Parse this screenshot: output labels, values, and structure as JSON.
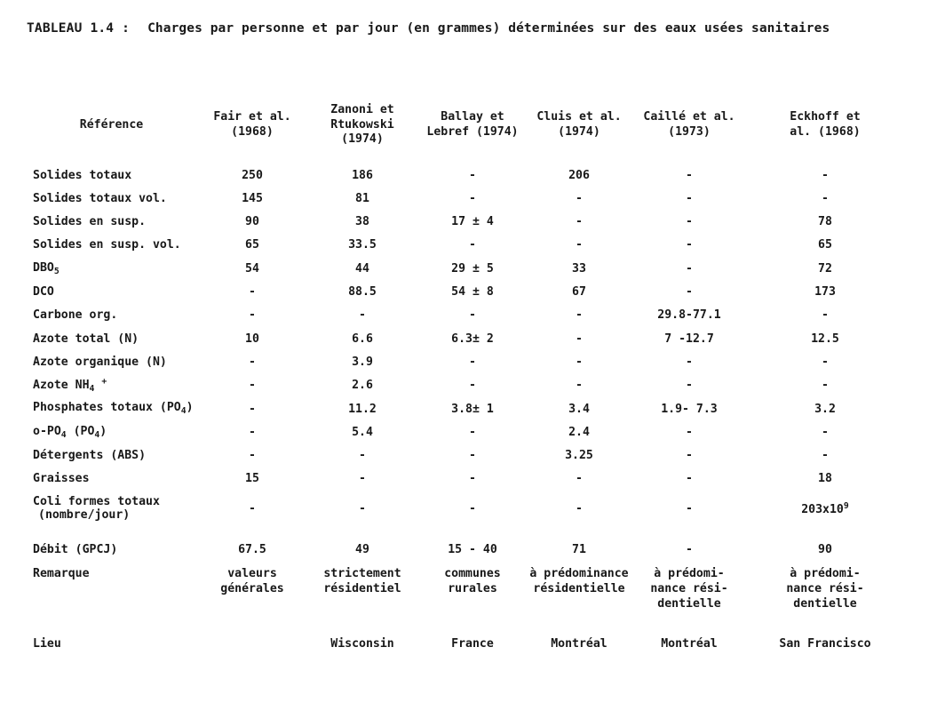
{
  "caption": {
    "label": "TABLEAU 1.4 :",
    "text": "Charges par personne et par jour  (en grammes)  déterminées sur des eaux usées sanitaires"
  },
  "table": {
    "header": {
      "reference_label": "Référence",
      "columns": [
        {
          "lines": [
            "Fair et al.",
            "(1968)"
          ]
        },
        {
          "lines": [
            "Zanoni et",
            "Rtukowski",
            "(1974)"
          ]
        },
        {
          "lines": [
            "Ballay et",
            "Lebref (1974)"
          ]
        },
        {
          "lines": [
            "Cluis et al.",
            "(1974)"
          ]
        },
        {
          "lines": [
            "Caillé et al.",
            "(1973)"
          ]
        },
        {
          "lines": [
            "Eckhoff et",
            "al. (1968)"
          ]
        }
      ]
    },
    "rows": [
      {
        "label": "Solides totaux",
        "values": [
          "250",
          "186",
          "-",
          "206",
          "-",
          "-"
        ]
      },
      {
        "label": "Solides totaux vol.",
        "values": [
          "145",
          "81",
          "-",
          "-",
          "-",
          "-"
        ]
      },
      {
        "label": "Solides en susp.",
        "values": [
          "90",
          "38",
          "17 ± 4",
          "-",
          "-",
          "78"
        ]
      },
      {
        "label": "Solides en susp. vol.",
        "values": [
          "65",
          "33.5",
          "-",
          "-",
          "-",
          "65"
        ]
      },
      {
        "label": "DBO5",
        "label_html": "DBO<sub>5</sub>",
        "values": [
          "54",
          "44",
          "29 ± 5",
          "33",
          "-",
          "72"
        ]
      },
      {
        "label": "DCO",
        "values": [
          "-",
          "88.5",
          "54 ± 8",
          "67",
          "-",
          "173"
        ]
      },
      {
        "label": "Carbone org.",
        "values": [
          "-",
          "-",
          "-",
          "-",
          "29.8-77.1",
          "-"
        ]
      },
      {
        "label": "Azote total (N)",
        "values": [
          "10",
          "6.6",
          "6.3± 2",
          "-",
          "7  -12.7",
          "12.5"
        ]
      },
      {
        "label": "Azote organique (N)",
        "values": [
          "-",
          "3.9",
          "-",
          "-",
          "-",
          "-"
        ]
      },
      {
        "label": "Azote NH4 +",
        "label_html": "Azote NH<sub>4</sub> <sup>+</sup>",
        "values": [
          "-",
          "2.6",
          "-",
          "-",
          "-",
          "-"
        ]
      },
      {
        "label": "Phosphates totaux (PO4)",
        "label_html": "Phosphates totaux (PO<sub>4</sub>)",
        "values": [
          "-",
          "11.2",
          "3.8± 1",
          "3.4",
          "1.9- 7.3",
          "3.2"
        ]
      },
      {
        "label": "o-PO4  (PO4)",
        "label_html": "o-PO<sub>4</sub>  (PO<sub>4</sub>)",
        "values": [
          "-",
          "5.4",
          "-",
          "2.4",
          "-",
          "-"
        ]
      },
      {
        "label": "Détergents (ABS)",
        "values": [
          "-",
          "-",
          "-",
          "3.25",
          "-",
          "-"
        ]
      },
      {
        "label": "Graisses",
        "values": [
          "15",
          "-",
          "-",
          "-",
          "-",
          "18"
        ]
      },
      {
        "label": "Coliformes totaux (nombre/jour)",
        "label_html": "Coli formes totaux<br><span style=\"padding-left:6px\">(nombre/jour)</span>",
        "values": [
          "-",
          "-",
          "-",
          "-",
          "-",
          "203x10<sup>9</sup>"
        ]
      },
      {
        "label": "Débit  (GPCJ)",
        "values": [
          "67.5",
          "49",
          "15  - 40",
          "71",
          "-",
          "90"
        ]
      }
    ],
    "remark": {
      "label": "Remarque",
      "values": [
        "valeurs<br>générales",
        "strictement<br>résidentiel",
        "communes<br>rurales",
        "à prédominance<br>résidentielle",
        "à prédomi-<br>nance rési-<br>dentielle",
        "à prédomi-<br>nance rési-<br>dentielle"
      ]
    },
    "lieu": {
      "label": "Lieu",
      "values": [
        "",
        "Wisconsin",
        "France",
        "Montréal",
        "Montréal",
        "San Francisco"
      ]
    }
  }
}
